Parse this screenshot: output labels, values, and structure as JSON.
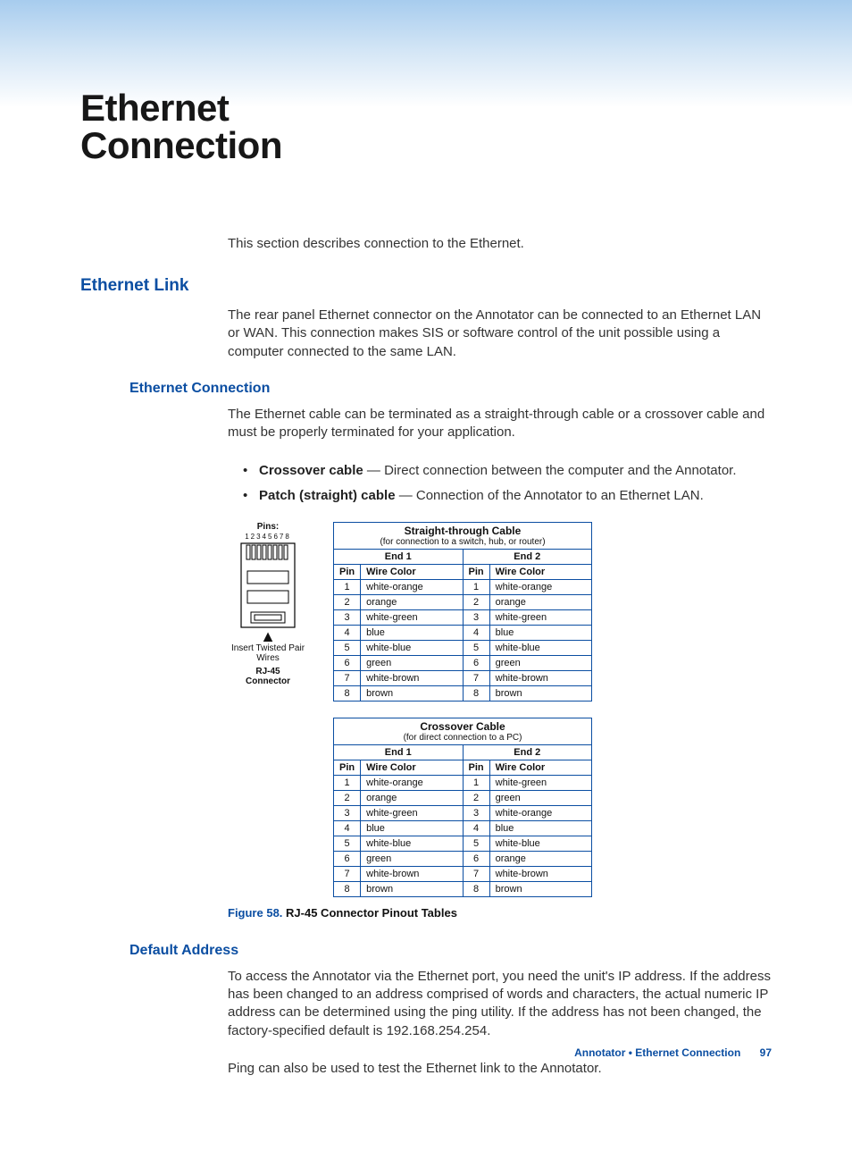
{
  "title_line1": "Ethernet",
  "title_line2": "Connection",
  "intro": "This section describes connection to the Ethernet.",
  "h2_ethernet_link": "Ethernet Link",
  "p_ethernet_link": "The rear panel Ethernet connector on the Annotator can be connected to an Ethernet LAN or WAN. This connection makes SIS or software control of the unit possible using a computer connected to the same LAN.",
  "h3_ethernet_connection": "Ethernet Connection",
  "p_ethernet_connection": "The Ethernet cable can be terminated as a straight-through cable or a crossover cable and must be properly terminated for your application.",
  "bullets": {
    "b1_strong": "Crossover cable",
    "b1_rest": " — Direct connection between the computer and the Annotator.",
    "b2_strong": "Patch (straight) cable",
    "b2_rest": " — Connection of the Annotator to an Ethernet LAN."
  },
  "rj45": {
    "pins_label": "Pins:",
    "pins_nums": "12345678",
    "twist": "Insert Twisted Pair Wires",
    "conn_l1": "RJ-45",
    "conn_l2": "Connector"
  },
  "table_headers": {
    "end1": "End 1",
    "end2": "End 2",
    "pin": "Pin",
    "wire": "Wire Color"
  },
  "straight": {
    "title": "Straight-through Cable",
    "sub": "(for connection to a switch, hub, or router)",
    "rows": [
      {
        "p": "1",
        "c1": "white-orange",
        "c2": "white-orange"
      },
      {
        "p": "2",
        "c1": "orange",
        "c2": "orange"
      },
      {
        "p": "3",
        "c1": "white-green",
        "c2": "white-green"
      },
      {
        "p": "4",
        "c1": "blue",
        "c2": "blue"
      },
      {
        "p": "5",
        "c1": "white-blue",
        "c2": "white-blue"
      },
      {
        "p": "6",
        "c1": "green",
        "c2": "green"
      },
      {
        "p": "7",
        "c1": "white-brown",
        "c2": "white-brown"
      },
      {
        "p": "8",
        "c1": "brown",
        "c2": "brown"
      }
    ]
  },
  "crossover": {
    "title": "Crossover Cable",
    "sub": "(for direct connection to a PC)",
    "rows": [
      {
        "p": "1",
        "c1": "white-orange",
        "c2": "white-green"
      },
      {
        "p": "2",
        "c1": "orange",
        "c2": "green"
      },
      {
        "p": "3",
        "c1": "white-green",
        "c2": "white-orange"
      },
      {
        "p": "4",
        "c1": "blue",
        "c2": "blue"
      },
      {
        "p": "5",
        "c1": "white-blue",
        "c2": "white-blue"
      },
      {
        "p": "6",
        "c1": "green",
        "c2": "orange"
      },
      {
        "p": "7",
        "c1": "white-brown",
        "c2": "white-brown"
      },
      {
        "p": "8",
        "c1": "brown",
        "c2": "brown"
      }
    ]
  },
  "figure_caption_lead": "Figure 58.",
  "figure_caption_rest": " RJ-45 Connector Pinout Tables",
  "h3_default_address": "Default Address",
  "p_default_address_1": "To access the Annotator via the Ethernet port, you need the unit's IP address. If the address has been changed to an address comprised of words and characters, the actual numeric IP address can be determined using the ping utility. If the address has not been changed, the factory-specified default is 192.168.254.254.",
  "p_default_address_2": "Ping can also be used to test the Ethernet link to the Annotator.",
  "footer_text": "Annotator • Ethernet Connection",
  "footer_page": "97"
}
